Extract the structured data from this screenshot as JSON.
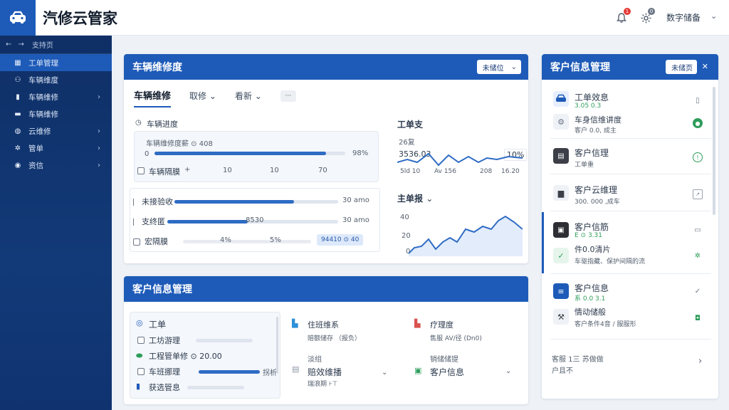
{
  "app": {
    "title": "汽修云管家"
  },
  "topbar": {
    "notif_badge": "1",
    "settings_badge": "0",
    "user_name": "数字储备"
  },
  "sidebar": {
    "crumb": "支持页",
    "items": [
      {
        "label": "工单管理",
        "active": true
      },
      {
        "label": "车辆维度"
      },
      {
        "label": "车辆维修"
      },
      {
        "label": "车辆维修"
      },
      {
        "label": "云维修"
      },
      {
        "label": "管单"
      },
      {
        "label": "资信"
      }
    ]
  },
  "vehicle_panel": {
    "title": "车辆维修度",
    "action_label": "未储位",
    "tabs": [
      "车辆维修",
      "取修",
      "看新"
    ],
    "progress_section": {
      "title": "车辆进度",
      "row1_label": "车辆维修度薪 ⊙ 408",
      "row1_start": "0",
      "row1_value": "98%",
      "row1_fill": 0.9,
      "row2_label": "车辆隔膜",
      "row2_plus": "+",
      "row2_vals": [
        "10",
        "10",
        "70"
      ]
    },
    "list_rows": [
      {
        "label": "未接验收",
        "value": "30 amo",
        "fill": 0.73
      },
      {
        "label": "支终匿",
        "value": "30 amo",
        "fill": 0.47,
        "mid": "8530"
      },
      {
        "label": "宏隔膜",
        "v1": "4%",
        "v2": "5%",
        "pill": "94410 ⊙ 40"
      }
    ],
    "mini_chart1": {
      "title": "工单支",
      "ylabel": "26复",
      "yvalue": "3536.03",
      "badge": "10%",
      "xticks": [
        "5ld 10",
        "Av 156",
        "208",
        "16.20"
      ]
    },
    "mini_chart2": {
      "title": "主单报",
      "yticks": [
        "40",
        "20",
        "0"
      ]
    }
  },
  "customer_panel": {
    "title": "客户信息管理",
    "action_label": "未储页",
    "cards": [
      {
        "title": "工单效息",
        "sub": "3.05 0.3",
        "line2": "车身信维讲度",
        "line2_sub": "客户 0.0, 成主"
      },
      {
        "title": "客户信理",
        "sub": "工单重"
      },
      {
        "title": "客户云维理",
        "sub": "300. 000 ,成车"
      },
      {
        "title": "客户信筋",
        "sub": "E ⊙ 3.31",
        "line2": "件0.0清片",
        "line2_sub": "车驱指藏、保护间隔的流"
      },
      {
        "title": "客户信息",
        "sub": "系 0.0 3.1",
        "line2": "情动储般",
        "line2_sub": "客户条件4音 / 服服形"
      }
    ],
    "footer_title": "客服 1三 苏做做",
    "footer_sub": "户且不"
  },
  "bottom_panel": {
    "title": "客户信息管理",
    "left_list": {
      "head": "工单",
      "rows": [
        {
          "label": "工坊游理"
        },
        {
          "label": "工程管单修 ⊙ 20.00"
        },
        {
          "label": "车班挪理",
          "value": "拐析"
        },
        {
          "label": "获选管息"
        }
      ]
    },
    "mid_card": {
      "title": "住班维系",
      "sub": "赔额储存 （报负）",
      "row2_title": "淡组",
      "row2_val": "赔效维播",
      "row2_sub": "瑞浪期 ⊦⊤"
    },
    "right_card": {
      "title": "疗理度",
      "sub": "售服 AV/径 (Dn0)",
      "row2_title": "销储储提",
      "row2_val": "客户信息"
    }
  },
  "colors": {
    "primary": "#1e5bb8",
    "sidebar": "#0f2f66",
    "success": "#2e9d5b"
  }
}
